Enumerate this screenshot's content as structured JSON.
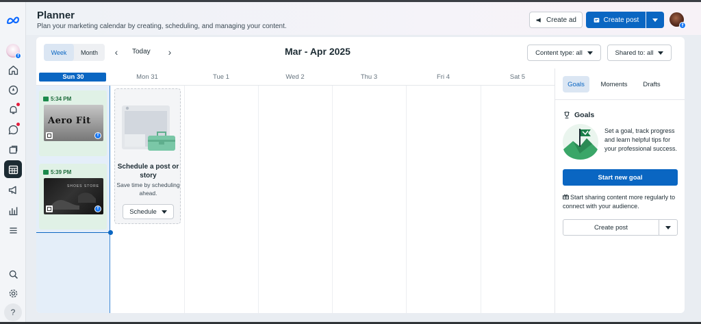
{
  "header": {
    "title": "Planner",
    "subtitle": "Plan your marketing calendar by creating, scheduling, and managing your content.",
    "create_ad_label": "Create ad",
    "create_post_label": "Create post"
  },
  "toolbar": {
    "view_week": "Week",
    "view_month": "Month",
    "today_label": "Today",
    "date_range": "Mar - Apr 2025",
    "content_type_label": "Content type: all",
    "shared_to_label": "Shared to: all"
  },
  "calendar": {
    "days": [
      "Sun 30",
      "Mon 31",
      "Tue 1",
      "Wed 2",
      "Thu 3",
      "Fri 4",
      "Sat 5"
    ],
    "today_index": 0,
    "posts": [
      {
        "time": "5:34 PM",
        "thumb_text": "Aero Fit",
        "thumb_subtext": ""
      },
      {
        "time": "5:39 PM",
        "thumb_text": "",
        "thumb_subtext": "SHOES STORE"
      }
    ],
    "schedule_card": {
      "title": "Schedule a post or story",
      "description": "Save time by scheduling ahead.",
      "button_label": "Schedule"
    }
  },
  "side_panel": {
    "tabs": [
      "Goals",
      "Moments",
      "Drafts"
    ],
    "active_tab": "Goals",
    "goals_heading": "Goals",
    "goals_text": "Set a goal, track progress and learn helpful tips for your professional success.",
    "start_goal_label": "Start new goal",
    "sharing_text": "Start sharing content more regularly to connect with your audience.",
    "create_post_label": "Create post"
  },
  "colors": {
    "accent": "#0a66c2",
    "today_column": "#e4eef9",
    "post_card": "#e0f1e6",
    "notification": "#e41e3f"
  },
  "icons": {
    "rail": [
      "meta-logo-icon",
      "business-avatar",
      "home-icon",
      "compass-icon",
      "notifications-icon",
      "messages-icon",
      "content-icon",
      "planner-icon",
      "ads-icon",
      "insights-icon",
      "menu-icon",
      "search-icon",
      "settings-icon",
      "help-icon"
    ]
  }
}
